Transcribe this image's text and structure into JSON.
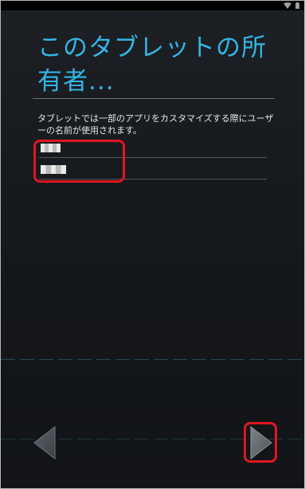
{
  "status_bar": {
    "wifi_icon": "wifi-icon",
    "battery_icon": "battery-icon"
  },
  "setup": {
    "title": "このタブレットの所有者...",
    "description": "タブレットでは一部のアプリをカスタマイズする際にユーザーの名前が使用されます。",
    "first_name_value": "■■",
    "last_name_value": "■■■"
  },
  "navigation": {
    "back_icon": "arrow-left-icon",
    "next_icon": "arrow-right-icon"
  },
  "colors": {
    "accent": "#33b5e5",
    "highlight": "#e01622",
    "background": "#15181c"
  }
}
